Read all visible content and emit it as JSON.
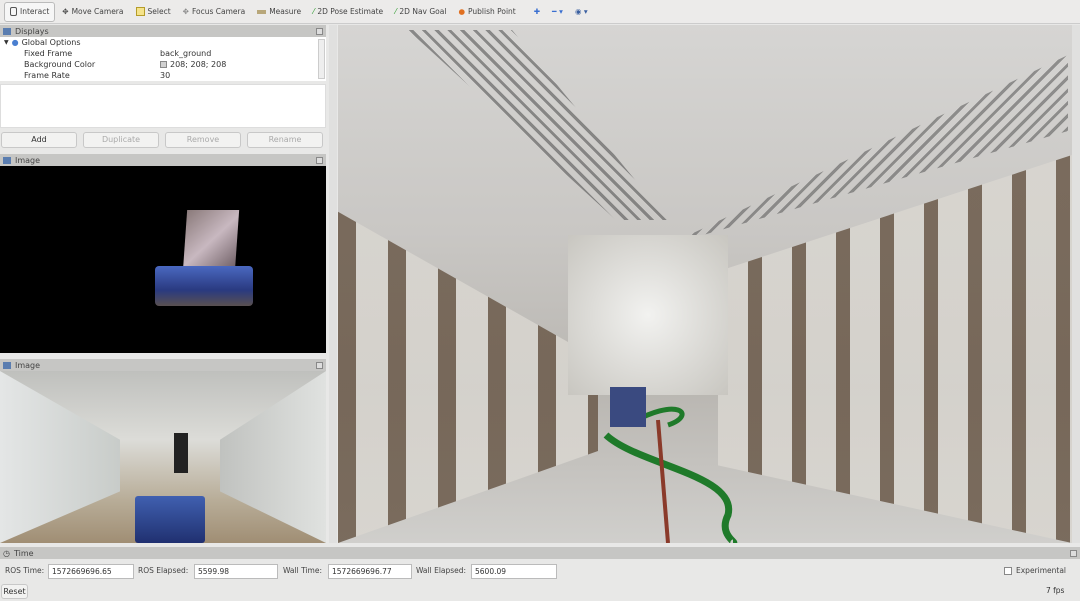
{
  "toolbar": {
    "tools": [
      "Interact",
      "Move Camera",
      "Select",
      "Focus Camera",
      "Measure",
      "2D Pose Estimate",
      "2D Nav Goal",
      "Publish Point"
    ]
  },
  "displays": {
    "title": "Displays",
    "global_options": "Global Options",
    "properties": [
      {
        "key": "Fixed Frame",
        "value": "back_ground"
      },
      {
        "key": "Background Color",
        "value": "208; 208; 208"
      },
      {
        "key": "Frame Rate",
        "value": "30"
      }
    ],
    "buttons": {
      "add": "Add",
      "duplicate": "Duplicate",
      "remove": "Remove",
      "rename": "Rename"
    }
  },
  "image_panels": [
    {
      "title": "Image"
    },
    {
      "title": "Image"
    }
  ],
  "time": {
    "title": "Time",
    "ros_time_label": "ROS Time:",
    "ros_time": "1572669696.65",
    "ros_elapsed_label": "ROS Elapsed:",
    "ros_elapsed": "5599.98",
    "wall_time_label": "Wall Time:",
    "wall_time": "1572669696.77",
    "wall_elapsed_label": "Wall Elapsed:",
    "wall_elapsed": "5600.09",
    "experimental": "Experimental",
    "reset": "Reset",
    "fps": "7 fps"
  },
  "colors": {
    "background": "#d0d0d0",
    "path": "#1f7a2a"
  }
}
